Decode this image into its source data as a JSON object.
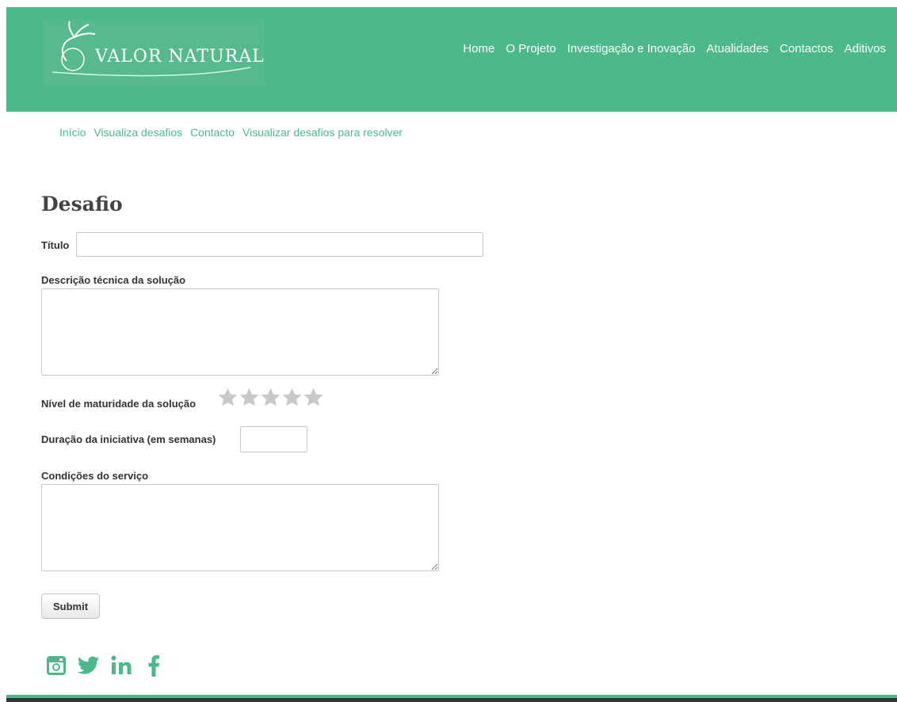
{
  "brand": {
    "name": "VALOR NATURAL",
    "accent": "#4db88a"
  },
  "nav": [
    {
      "label": "Home"
    },
    {
      "label": "O Projeto"
    },
    {
      "label": "Investigação e Inovação"
    },
    {
      "label": "Atualidades"
    },
    {
      "label": "Contactos"
    },
    {
      "label": "Aditivos"
    }
  ],
  "breadcrumbs": [
    {
      "label": "Início"
    },
    {
      "label": "Visualiza desafios"
    },
    {
      "label": "Contacto"
    },
    {
      "label": "Visualizar desafios para resolver"
    }
  ],
  "form": {
    "title": "Desafio",
    "titulo_label": "Título",
    "titulo_value": "",
    "descricao_label": "Descrição técnica da solução",
    "descricao_value": "",
    "maturidade_label": "Nível de maturidade da solução",
    "maturidade_rating": 0,
    "maturidade_max": 5,
    "duracao_label": "Duração da iniciativa (em semanas)",
    "duracao_value": "",
    "condicoes_label": "Condições do serviço",
    "condicoes_value": "",
    "submit_label": "Submit"
  },
  "social": [
    "instagram-icon",
    "twitter-icon",
    "linkedin-icon",
    "facebook-icon"
  ]
}
